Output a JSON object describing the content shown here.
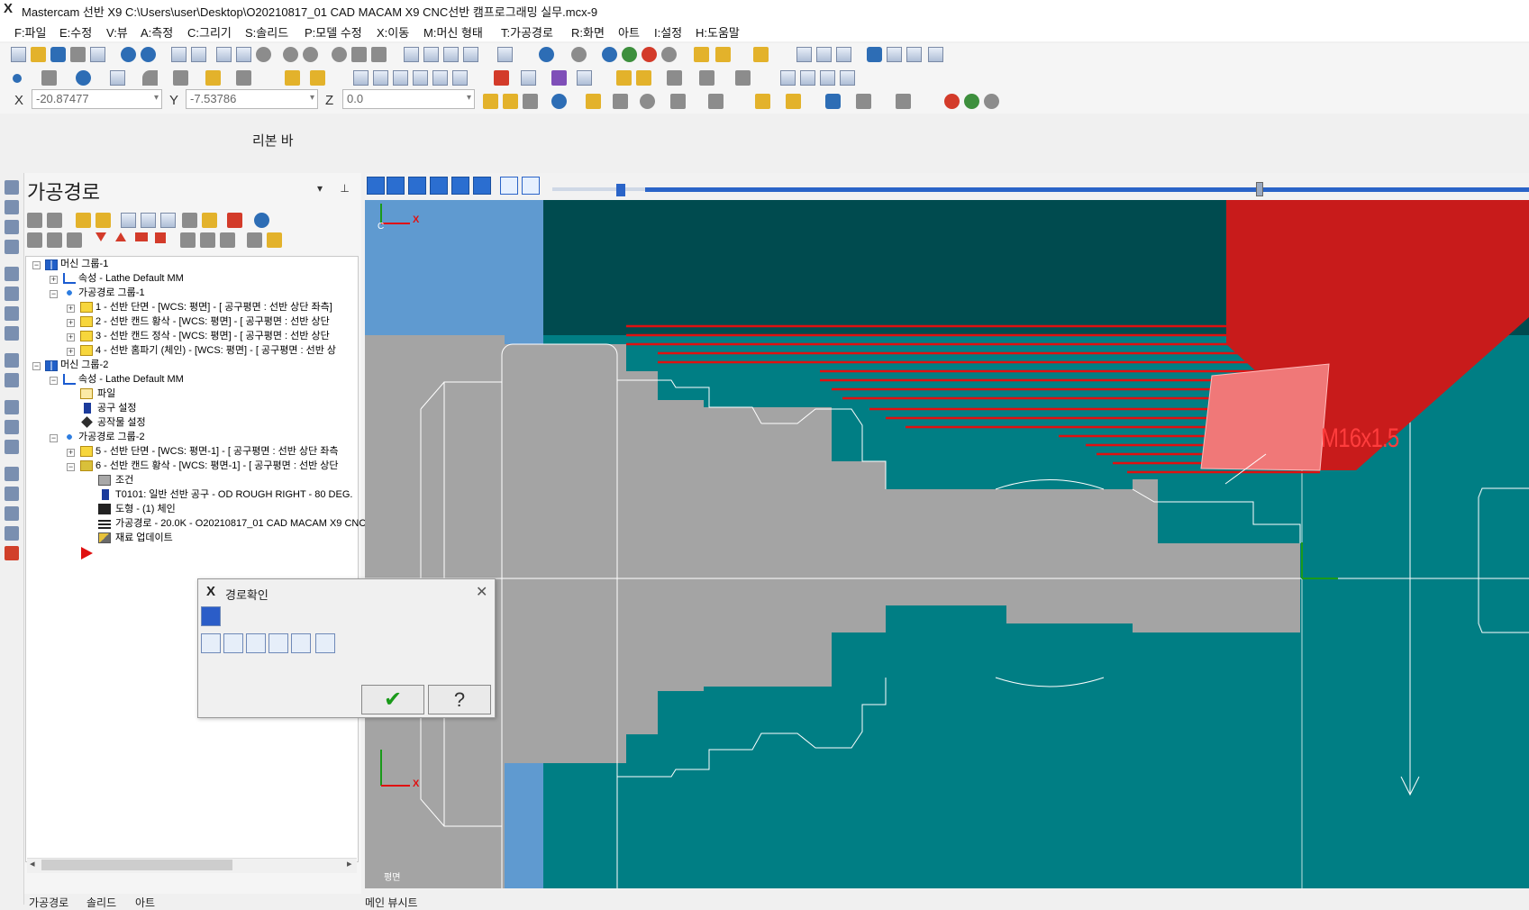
{
  "title": {
    "text": "Mastercam 선반 X9  C:\\Users\\user\\Desktop\\O20210817_01 CAD MACAM X9 CNC선반 캠프로그래밍 실무.mcx-9",
    "logo": "X"
  },
  "menu": [
    "F:파일",
    "E:수정",
    "V:뷰",
    "A:측정",
    "C:그리기",
    "S:솔리드",
    "P:모델 수정",
    "X:이동",
    "M:머신 형태",
    "T:가공경로",
    "R:화면",
    "아트",
    "I:설정",
    "H:도움말"
  ],
  "coords": {
    "x_label": "X",
    "x_value": "-20.87477",
    "y_label": "Y",
    "y_value": "-7.53786",
    "z_label": "Z",
    "z_value": "0.0"
  },
  "ribbon_label": "리본 바",
  "panel": {
    "title": "가공경로",
    "controls": "▾ ⊥ ✕",
    "tabs": [
      "가공경로",
      "솔리드",
      "아트"
    ]
  },
  "tree": [
    {
      "label": "머신 그룹-1",
      "icon": "machine-group-icon"
    },
    {
      "label": "속성 - Lathe Default MM",
      "icon": "properties-icon"
    },
    {
      "label": "가공경로 그룹-1",
      "icon": "toolpath-group-icon"
    },
    {
      "label": "1 - 선반 단면 - [WCS: 평면] - [ 공구평면 : 선반 상단 좌측]",
      "icon": "folder-icon"
    },
    {
      "label": "2 - 선반 캔드 황삭 - [WCS: 평면] - [ 공구평면 : 선반 상단",
      "icon": "folder-icon"
    },
    {
      "label": "3 - 선반 캔드 정삭 - [WCS: 평면] - [ 공구평면 : 선반 상단",
      "icon": "folder-icon"
    },
    {
      "label": "4 - 선반 홈파기 (체인) - [WCS: 평면] - [ 공구평면 : 선반 상",
      "icon": "folder-icon"
    },
    {
      "label": "머신 그룹-2",
      "icon": "machine-group-icon"
    },
    {
      "label": "속성 - Lathe Default MM",
      "icon": "properties-icon"
    },
    {
      "label": "파일",
      "icon": "file-folder-icon"
    },
    {
      "label": "공구 설정",
      "icon": "tool-settings-icon"
    },
    {
      "label": "공작물 설정",
      "icon": "stock-settings-icon"
    },
    {
      "label": "가공경로 그룹-2",
      "icon": "toolpath-group-icon"
    },
    {
      "label": "5 - 선반 단면 - [WCS: 평면-1] - [ 공구평면 : 선반 상단 좌측",
      "icon": "folder-icon"
    },
    {
      "label": "6 - 선반 캔드 황삭 - [WCS: 평면-1] - [ 공구평면 : 선반 상단",
      "icon": "folder-open-icon"
    },
    {
      "label": "조건",
      "icon": "parameters-icon"
    },
    {
      "label": "T0101: 일반 선반 공구 - OD ROUGH RIGHT - 80 DEG.",
      "icon": "tool-icon"
    },
    {
      "label": "도형 - (1) 체인",
      "icon": "geometry-icon"
    },
    {
      "label": "가공경로 - 20.0K - O20210817_01 CAD MACAM X9 CNC",
      "icon": "toolpath-icon"
    },
    {
      "label": "재료 업데이트",
      "icon": "stock-update-icon"
    }
  ],
  "dialog": {
    "title": "경로확인",
    "logo": "X",
    "close": "✕",
    "ok": "✔",
    "help": "?"
  },
  "viewport": {
    "view_label": "평면",
    "thread_label": "M16x1.5",
    "axis_x": "X",
    "axis_c": "C",
    "bottom_tab": "메인 뷰시트",
    "colors": {
      "background": "#007a80",
      "part": "#a4a4a4",
      "tool": "#d21e1e",
      "toolpath": "#e01010",
      "stock_blue": "#5f9ad0"
    }
  }
}
